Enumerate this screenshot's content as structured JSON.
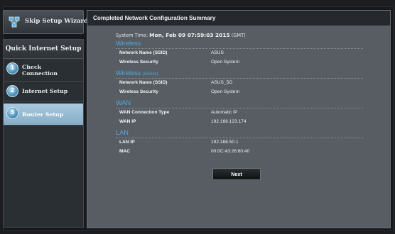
{
  "sidebar": {
    "skip_label": "Skip Setup Wizard",
    "panel_title": "Quick Internet Setup",
    "steps": [
      {
        "num": "1",
        "label_line1": "Check",
        "label_line2": "Connection"
      },
      {
        "num": "2",
        "label_line1": "Internet Setup",
        "label_line2": ""
      },
      {
        "num": "3",
        "label_line1": "Router Setup",
        "label_line2": ""
      }
    ],
    "active_step": 3
  },
  "main": {
    "title": "Completed Network Configuration Summary",
    "system_time_label": "System Time:",
    "system_time_value": "Mon, Feb 09 07:59:03 2015",
    "system_time_zone": "(GMT)",
    "sections": [
      {
        "title": "Wireless",
        "title_suffix": "",
        "rows": [
          {
            "key": "Network Name (SSID)",
            "value": "ASUS"
          },
          {
            "key": "Wireless Security",
            "value": "Open System"
          }
        ]
      },
      {
        "title": "Wireless",
        "title_suffix": "(5GHz)",
        "rows": [
          {
            "key": "Network Name (SSID)",
            "value": "ASUS_5G"
          },
          {
            "key": "Wireless Security",
            "value": "Open System"
          }
        ]
      },
      {
        "title": "WAN",
        "title_suffix": "",
        "rows": [
          {
            "key": "WAN Connection Type",
            "value": "Automatic IP"
          },
          {
            "key": "WAN IP",
            "value": "192.168.123.174"
          }
        ]
      },
      {
        "title": "LAN",
        "title_suffix": "",
        "rows": [
          {
            "key": "LAN IP",
            "value": "192.168.50.1"
          },
          {
            "key": "MAC",
            "value": "00:0C:43:26:60:40"
          }
        ]
      }
    ],
    "next_label": "Next"
  },
  "colors": {
    "section_heading": "#4fa9e6",
    "active_step_bg": "#9fc1d8",
    "panel_bg": "#575d62",
    "header_bg": "#25292d"
  },
  "icons": {
    "skip": "network-icon",
    "step": "numbered-circle-icon"
  }
}
